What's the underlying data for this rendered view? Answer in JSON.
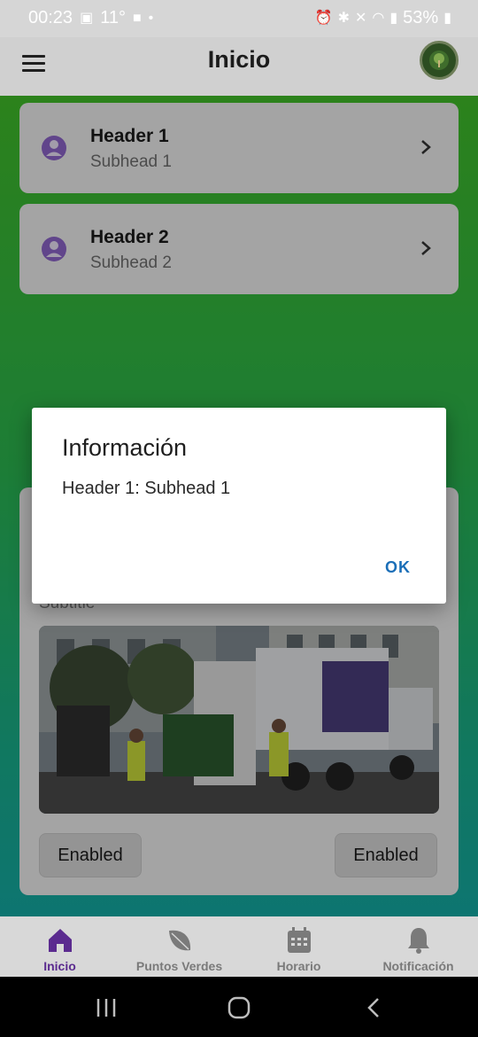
{
  "statusbar": {
    "time": "00:23",
    "temp": "11°",
    "battery": "53%"
  },
  "appbar": {
    "title": "Inicio"
  },
  "list": [
    {
      "header": "Header 1",
      "subhead": "Subhead 1"
    },
    {
      "header": "Header 2",
      "subhead": "Subhead 2"
    }
  ],
  "card": {
    "subtitle": "Subtitle",
    "button_left": "Enabled",
    "button_right": "Enabled"
  },
  "dialog": {
    "title": "Información",
    "message": "Header 1: Subhead 1",
    "ok_label": "OK"
  },
  "bottom_nav": [
    {
      "label": "Inicio",
      "icon": "home-icon",
      "active": true
    },
    {
      "label": "Puntos Verdes",
      "icon": "leaf-icon",
      "active": false
    },
    {
      "label": "Horario",
      "icon": "calendar-icon",
      "active": false
    },
    {
      "label": "Notificación",
      "icon": "bell-icon",
      "active": false
    }
  ],
  "colors": {
    "accent": "#5b2b8f",
    "dialog_button": "#1c6fb8",
    "gradient_top": "#3fba28",
    "gradient_bottom": "#14a8a2"
  }
}
